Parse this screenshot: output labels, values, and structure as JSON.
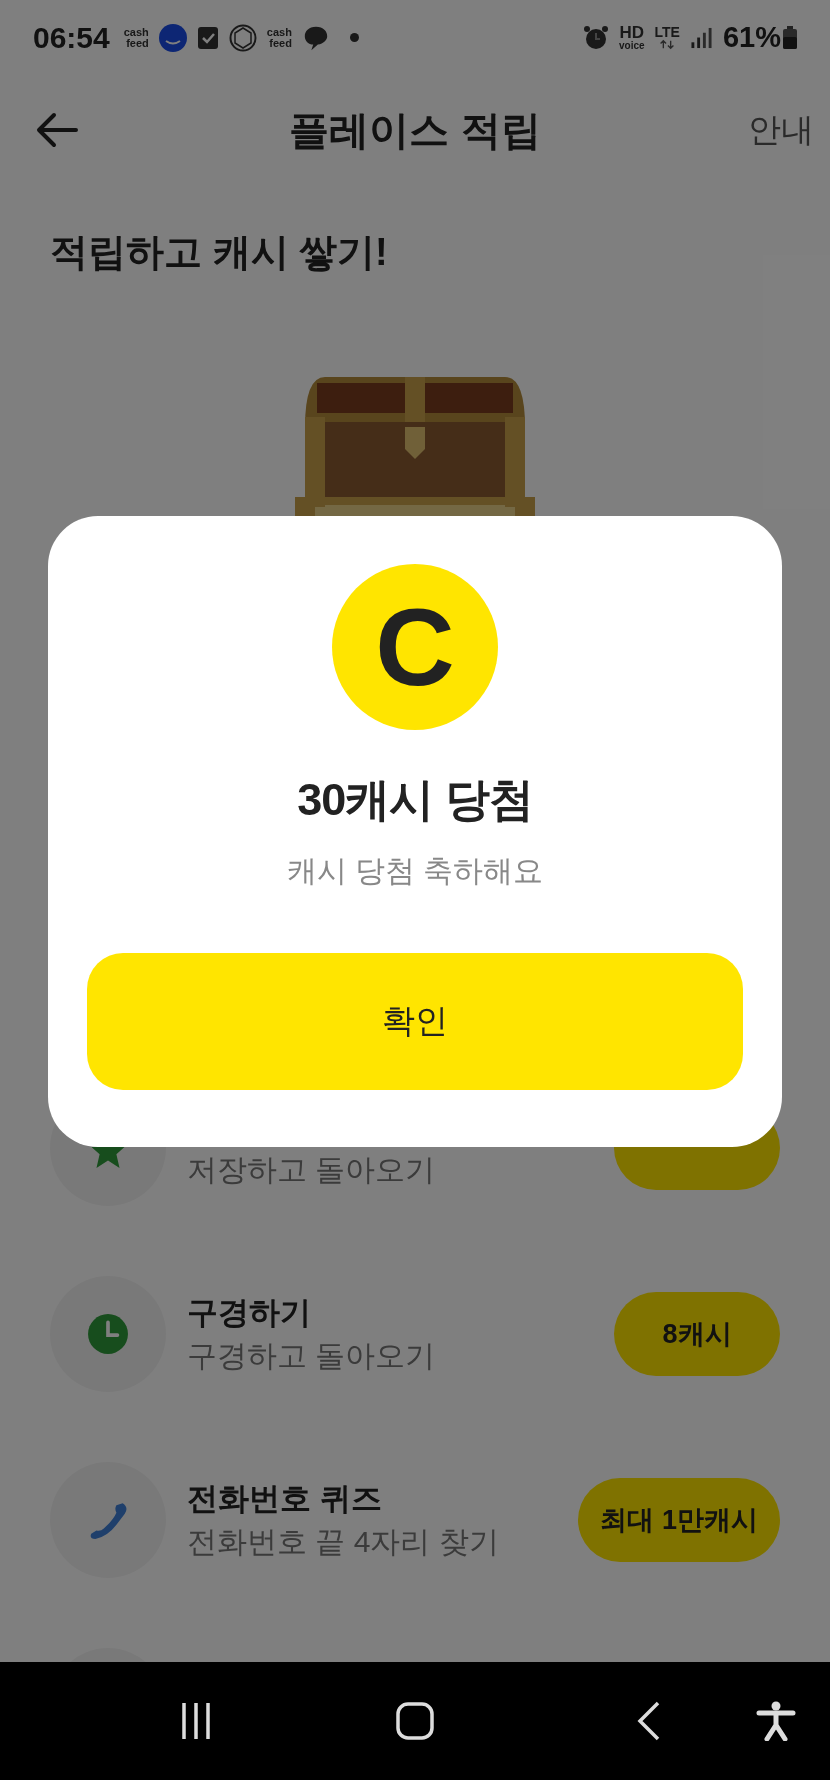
{
  "status_bar": {
    "time": "06:54",
    "notification_labels": [
      "cash\nfeed",
      "cash\nfeed"
    ],
    "network": {
      "hd": "HD",
      "voice": "voice",
      "lte": "LTE"
    },
    "battery": "61%"
  },
  "header": {
    "title": "플레이스 적립",
    "action": "안내"
  },
  "heading": "적립하고 캐시 쌓기!",
  "missions": [
    {
      "kind": "star",
      "subtitle": "저장하고 돌아오기",
      "badge": true
    },
    {
      "kind": "clock",
      "title": "구경하기",
      "subtitle": "구경하고 돌아오기",
      "reward": "8캐시"
    },
    {
      "kind": "phone",
      "title": "전화번호 퀴즈",
      "subtitle": "전화번호 끝 4자리 찾기",
      "reward": "최대 1만캐시"
    },
    {
      "kind": "blank"
    }
  ],
  "dialog": {
    "coin": "C",
    "title": "30캐시 당첨",
    "message": "캐시 당첨 축하해요",
    "button": "확인"
  }
}
